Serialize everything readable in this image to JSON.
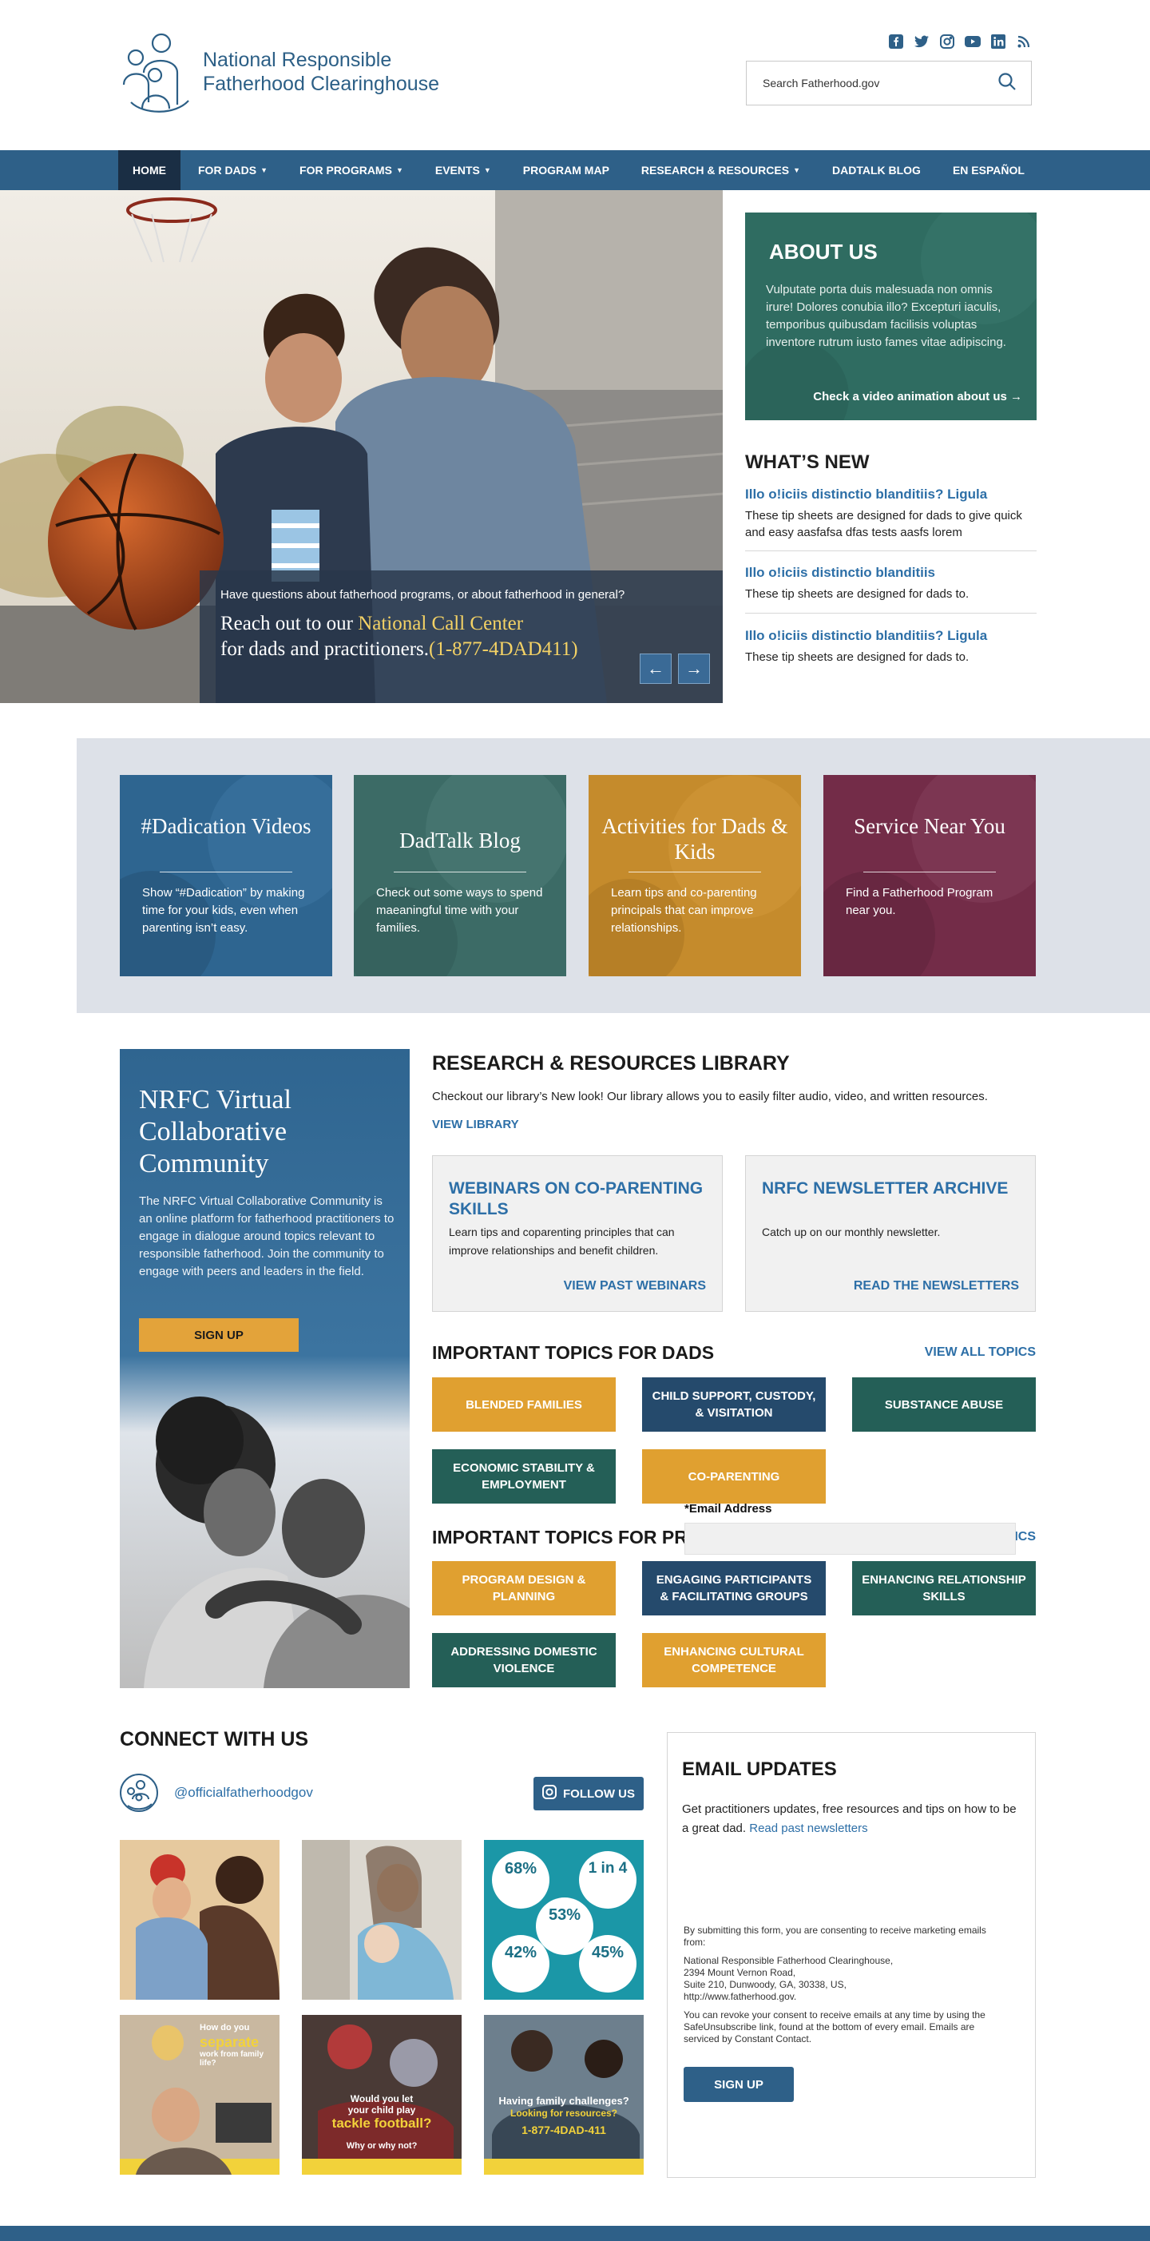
{
  "header": {
    "logo_line1": "National Responsible",
    "logo_line2": "Fatherhood Clearinghouse",
    "social_icons": [
      "facebook-icon",
      "twitter-icon",
      "instagram-icon",
      "youtube-icon",
      "linkedin-icon",
      "rss-icon"
    ],
    "search_placeholder": "Search Fatherhood.gov"
  },
  "nav": {
    "items": [
      {
        "label": "HOME",
        "active": true,
        "dropdown": false
      },
      {
        "label": "FOR DADS",
        "dropdown": true
      },
      {
        "label": "FOR PROGRAMS",
        "dropdown": true
      },
      {
        "label": "EVENTS",
        "dropdown": true
      },
      {
        "label": "PROGRAM MAP",
        "dropdown": false
      },
      {
        "label": "RESEARCH & RESOURCES",
        "dropdown": true
      },
      {
        "label": "DADTALK BLOG",
        "dropdown": false
      },
      {
        "label": "EN ESPAÑOL",
        "dropdown": false
      }
    ]
  },
  "hero": {
    "question": "Have questions about fatherhood programs, or about fatherhood in general?",
    "line1_prefix": "Reach out to our ",
    "line1_highlight": "National Call Center",
    "line2_prefix": "for dads and practitioners.",
    "line2_phone": "(1-877-4DAD411)"
  },
  "about": {
    "title": "ABOUT US",
    "body": "Vulputate porta duis malesuada non omnis irure! Dolores conubia illo? Excepturi iaculis, temporibus quibusdam facilisis voluptas inventore rutrum iusto fames vitae adipiscing.",
    "link": "Check a video animation about us →"
  },
  "whats_new": {
    "title": "WHAT’S NEW",
    "items": [
      {
        "title": "Illo o!iciis distinctio blanditiis? Ligula",
        "desc": "These tip sheets are designed for dads to give quick and easy aasfafsa dfas tests aasfs lorem"
      },
      {
        "title": "Illo o!iciis distinctio blanditiis",
        "desc": "These tip sheets are designed for dads to."
      },
      {
        "title": "Illo o!iciis distinctio blanditiis? Ligula",
        "desc": "These tip sheets are designed for dads to."
      }
    ]
  },
  "features": [
    {
      "title": "#Dadication Videos",
      "desc": "Show “#Dadication” by making time for your kids, even when parenting isn’t easy.",
      "color": "#2e6590"
    },
    {
      "title": "DadTalk Blog",
      "desc": "Check out some ways to spend maeaningful time with your families.",
      "color": "#3c6b66"
    },
    {
      "title": "Activities for Dads & Kids",
      "desc": "Learn tips and co-parenting principals that can improve relationships.",
      "color": "#c58b2c"
    },
    {
      "title": "Service Near You",
      "desc": "Find a Fatherhood Program near you.",
      "color": "#732c48"
    }
  ],
  "virtual": {
    "title": "NRFC Virtual Collaborative Community",
    "body": "The NRFC Virtual Collaborative Community is an online platform for fatherhood practitioners to engage in dialogue around topics relevant to responsible fatherhood. Join the community to engage with peers and leaders in the field.",
    "button": "SIGN UP"
  },
  "research": {
    "title": "RESEARCH & RESOURCES LIBRARY",
    "desc": "Checkout our library’s New look! Our library allows you to easily filter audio, video, and written resources.",
    "link": "VIEW LIBRARY",
    "cards": [
      {
        "title": "WEBINARS ON CO-PARENTING SKILLS",
        "desc": "Learn tips and coparenting principles that can improve relationships and benefit children.",
        "link": "VIEW PAST WEBINARS"
      },
      {
        "title": "NRFC NEWSLETTER ARCHIVE",
        "desc": "Catch up on our monthly newsletter.",
        "link": "READ THE NEWSLETTERS"
      }
    ]
  },
  "topics_dads": {
    "title": "IMPORTANT TOPICS FOR DADS",
    "link": "VIEW ALL TOPICS",
    "tiles": [
      "BLENDED FAMILIES",
      "CHILD SUPPORT, CUSTODY, & VISITATION",
      "SUBSTANCE ABUSE",
      "ECONOMIC STABILITY & EMPLOYMENT",
      "CO-PARENTING"
    ]
  },
  "topics_programs": {
    "title": "IMPORTANT TOPICS FOR PRAC",
    "link": "ICS",
    "tiles": [
      "PROGRAM DESIGN & PLANNING",
      "ENGAGING PARTICIPANTS & FACILITATING GROUPS",
      "ENHANCING RELATIONSHIP SKILLS",
      "ADDRESSING DOMESTIC VIOLENCE",
      "ENHANCING CULTURAL COMPETENCE"
    ]
  },
  "email_overlay": {
    "label": "*Email Address"
  },
  "connect": {
    "title": "CONNECT WITH US",
    "handle": "@officialfatherhoodgov",
    "follow": "FOLLOW US",
    "ig_posts": [
      {
        "kind": "photo"
      },
      {
        "kind": "photo"
      },
      {
        "kind": "stats",
        "stats": [
          {
            "value": "68%"
          },
          {
            "value": "1 in 4"
          },
          {
            "value": "53%"
          },
          {
            "value": "42%"
          },
          {
            "value": "45%"
          }
        ]
      },
      {
        "kind": "poster",
        "line1": "How do you",
        "line2": "separate",
        "line3": "work from family life?"
      },
      {
        "kind": "poster",
        "line1": "Would you let",
        "line2": "your child play",
        "line3": "tackle football?",
        "line4": "Why or why not?"
      },
      {
        "kind": "poster",
        "line1": "Having family challenges?",
        "line2": "Looking for resources?",
        "line3": "1-877-4DAD-411"
      }
    ]
  },
  "email_updates": {
    "title": "EMAIL UPDATES",
    "intro": "Get practitioners updates, free resources and tips on how to be a great dad. ",
    "intro_link": "Read past newsletters",
    "consent": "By submitting this form, you are consenting to receive marketing emails from:",
    "address1": "National Responsible Fatherhood Clearinghouse,",
    "address2": "2394 Mount Vernon Road,",
    "address3": "Suite 210, Dunwoody, GA, 30338, US,",
    "address4": "http://www.fatherhood.gov.",
    "revoke": "You can revoke your consent to receive emails at any time by using the SafeUnsubscribe link, found at the bottom of every email. Emails are serviced by  Constant Contact.",
    "button": "SIGN UP"
  }
}
